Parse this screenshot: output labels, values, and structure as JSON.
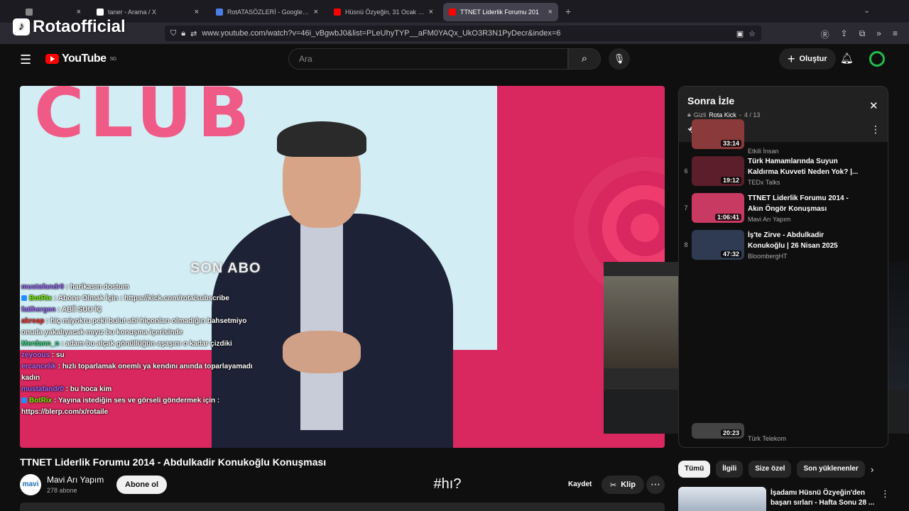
{
  "overlay": {
    "brand": "Rotaofficial"
  },
  "browser": {
    "tabs": [
      {
        "title": "",
        "color": "#888888"
      },
      {
        "title": "taner - Arama / X",
        "color": "#ffffff"
      },
      {
        "title": "RotATASÖZLERİ - Google Dokü",
        "color": "#4a7ee8"
      },
      {
        "title": "Hüsnü Özyeğin, 31 Ocak 2017",
        "color": "#ff0000"
      },
      {
        "title": "TTNET Liderlik Forumu 201",
        "color": "#ff0000"
      }
    ],
    "url": "www.youtube.com/watch?v=46i_vBgwbJ0&list=PLeUhyTYP__aFM0YAQx_UkO3R3N1PyDecr&index=6"
  },
  "youtube": {
    "logo_text": "YouTube",
    "region": "SG",
    "search_placeholder": "Ara",
    "create_label": "Oluştur"
  },
  "video": {
    "overlay_text": "SON ABO",
    "big_text": "CLUB",
    "title": "TTNET Liderlik Forumu 2014 - Abdulkadir Konukoğlu Konuşması",
    "channel": "Mavi Arı Yapım",
    "channel_avatar_text": "mavi arı",
    "subscribers": "278 abone",
    "subscribe_label": "Abone ol",
    "caption": "#hı?",
    "save_label": "Kaydet",
    "clip_label": "Klip"
  },
  "chat": [
    {
      "user": "mustafandr0",
      "color": "#9b6bff",
      "msg": "harikasın dostum"
    },
    {
      "user": "BotRix",
      "color": "#7CFC00",
      "msg": "Abone Olmak İçin : https://kick.com/rota/subscribe",
      "badge": true
    },
    {
      "user": "fatihergen",
      "color": "#9b6bff",
      "msg": "ABİİ SUU İÇ"
    },
    {
      "user": "akreap",
      "color": "#ff3b3b",
      "msg": "hiç miyokru peki bulut abi hiçonları olmadığın bahsetmiyo onuda yakalıyacak mıyız bu konuşma içerisinde"
    },
    {
      "user": "Merdann_n",
      "color": "#3ddc84",
      "msg": "adam bu alçak gönüllüğün aşaşını o kadar çizdiki"
    },
    {
      "user": "zeyoous",
      "color": "#b86bff",
      "msg": "su"
    },
    {
      "user": "ercancelik",
      "color": "#b86bff",
      "msg": "hızlı toparlamak onemlı ya kendını anında toparlayamadı kadın"
    },
    {
      "user": "mustafandr0",
      "color": "#9b6bff",
      "msg": "bu hoca kim"
    },
    {
      "user": "BotRix",
      "color": "#7CFC00",
      "msg": "Yayına istediğin ses ve görseli göndermek için : https://blerp.com/x/rotaile",
      "badge": true
    }
  ],
  "playlist": {
    "title": "Sonra İzle",
    "privacy": "Gizli",
    "owner": "Rota Kick",
    "position": "4 / 13",
    "items": [
      {
        "index": "",
        "duration": "33:14",
        "title": "",
        "channel": "Etkili İnsan",
        "thumb_color": "#8a3a3a"
      },
      {
        "index": "6",
        "duration": "19:12",
        "title": "Türk Hamamlarında Suyun Kaldırma Kuvveti Neden Yok? |...",
        "channel": "TEDx Talks",
        "thumb_color": "#5b1e2a"
      },
      {
        "index": "7",
        "duration": "1:06:41",
        "title": "TTNET Liderlik Forumu 2014 - Akın Öngör Konuşması",
        "channel": "Mavi Arı Yapım",
        "thumb_color": "#c83a62"
      },
      {
        "index": "8",
        "duration": "47:32",
        "title": "İş'te Zirve - Abdulkadir Konukoğlu | 26 Nisan 2025",
        "channel": "BloombergHT",
        "thumb_color": "#2f3b52"
      }
    ],
    "last_channel": "Türk Telekom",
    "last_duration": "20:23"
  },
  "chips": [
    "Tümü",
    "İlgili",
    "Size özel",
    "Son yüklenenler"
  ],
  "recommendation": {
    "title": "İşadamı Hüsnü Özyeğin'den başarı sırları - Hafta Sonu 28 ..."
  },
  "colors": {
    "accent_red": "#ff0000",
    "bg": "#0f0f0f",
    "avatar_ring": "#1fbd4c"
  }
}
